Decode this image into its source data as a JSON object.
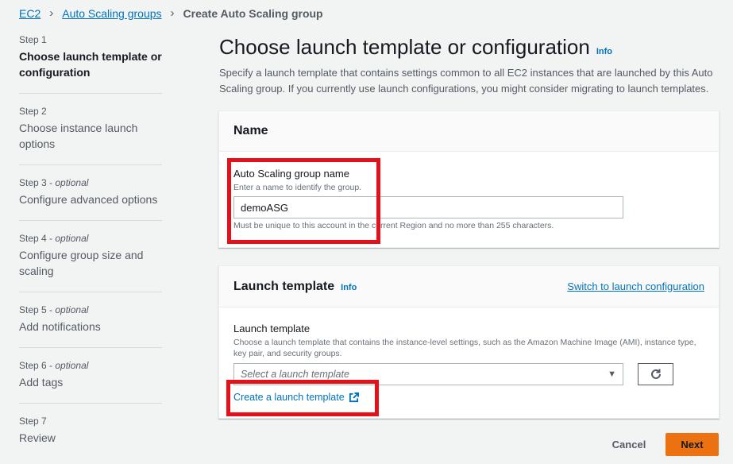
{
  "breadcrumb": {
    "items": [
      "EC2",
      "Auto Scaling groups"
    ],
    "current": "Create Auto Scaling group"
  },
  "steps": [
    {
      "num": "Step 1",
      "optional": "",
      "title": "Choose launch template or configuration"
    },
    {
      "num": "Step 2",
      "optional": "",
      "title": "Choose instance launch options"
    },
    {
      "num": "Step 3",
      "optional": "optional",
      "title": "Configure advanced options"
    },
    {
      "num": "Step 4",
      "optional": "optional",
      "title": "Configure group size and scaling"
    },
    {
      "num": "Step 5",
      "optional": "optional",
      "title": "Add notifications"
    },
    {
      "num": "Step 6",
      "optional": "optional",
      "title": "Add tags"
    },
    {
      "num": "Step 7",
      "optional": "",
      "title": "Review"
    }
  ],
  "page": {
    "title": "Choose launch template or configuration",
    "info": "Info",
    "description": "Specify a launch template that contains settings common to all EC2 instances that are launched by this Auto Scaling group. If you currently use launch configurations, you might consider migrating to launch templates."
  },
  "name_panel": {
    "header": "Name",
    "label": "Auto Scaling group name",
    "hint": "Enter a name to identify the group.",
    "value": "demoASG",
    "constraint": "Must be unique to this account in the current Region and no more than 255 characters."
  },
  "template_panel": {
    "header": "Launch template",
    "info": "Info",
    "switch_link": "Switch to launch configuration",
    "label": "Launch template",
    "hint": "Choose a launch template that contains the instance-level settings, such as the Amazon Machine Image (AMI), instance type, key pair, and security groups.",
    "select_placeholder": "Select a launch template",
    "create_link": "Create a launch template"
  },
  "footer": {
    "cancel": "Cancel",
    "next": "Next"
  },
  "colors": {
    "link": "#0073bb",
    "primary": "#ec7211",
    "highlight": "#e5101a"
  }
}
